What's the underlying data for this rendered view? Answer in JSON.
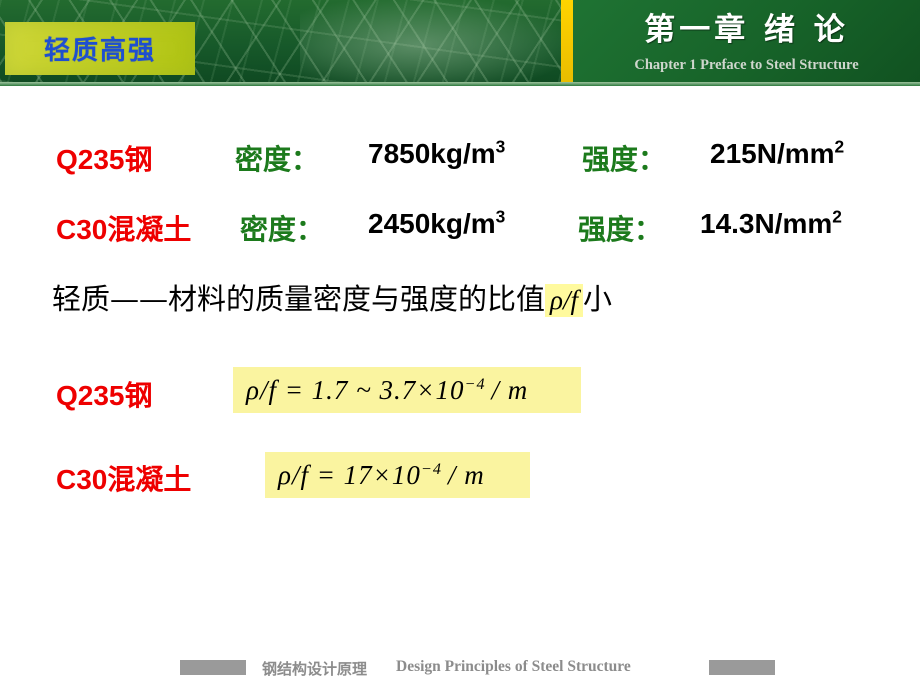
{
  "header": {
    "topic_tag": "轻质高强",
    "chapter_title": "第一章  绪 论",
    "chapter_subtitle": "Chapter 1   Preface to Steel Structure",
    "accent_yellow": "#ffd400",
    "band_green": "#176329",
    "tag_yellow": "#c2cf27",
    "tag_text_blue": "#1e4fd0"
  },
  "content": {
    "spec_rows": [
      {
        "material": "Q235钢",
        "density_label": "密度：",
        "density_value": "7850kg/m",
        "density_sup": "3",
        "strength_label": "强度：",
        "strength_value": "215N/mm",
        "strength_sup": "2"
      },
      {
        "material": "C30混凝土",
        "density_label": "密度：",
        "density_value": "2450kg/m",
        "density_sup": "3",
        "strength_label": "强度：",
        "strength_value": "14.3N/mm",
        "strength_sup": "2"
      }
    ],
    "definition": {
      "prefix": "轻质——材料的质量密度与强度的比值",
      "highlight": "ρ/f",
      "suffix": "小"
    },
    "formulas": [
      {
        "material": "Q235钢",
        "lhs": "ρ/f = 1.7 ~ 3.7×10",
        "exponent": "−4",
        "unit": "/ m"
      },
      {
        "material": "C30混凝土",
        "lhs": "ρ/f = 17×10",
        "exponent": "−4",
        "unit": "/ m"
      }
    ],
    "text_colors": {
      "material_red": "#ee0000",
      "label_green": "#1c7a1c",
      "value_black": "#000000",
      "highlight_yellow": "#fffa9e"
    }
  },
  "footer": {
    "title_cn": "钢结构设计原理",
    "title_en": "Design Principles of Steel Structure",
    "bar_color": "#9a9a9a"
  }
}
